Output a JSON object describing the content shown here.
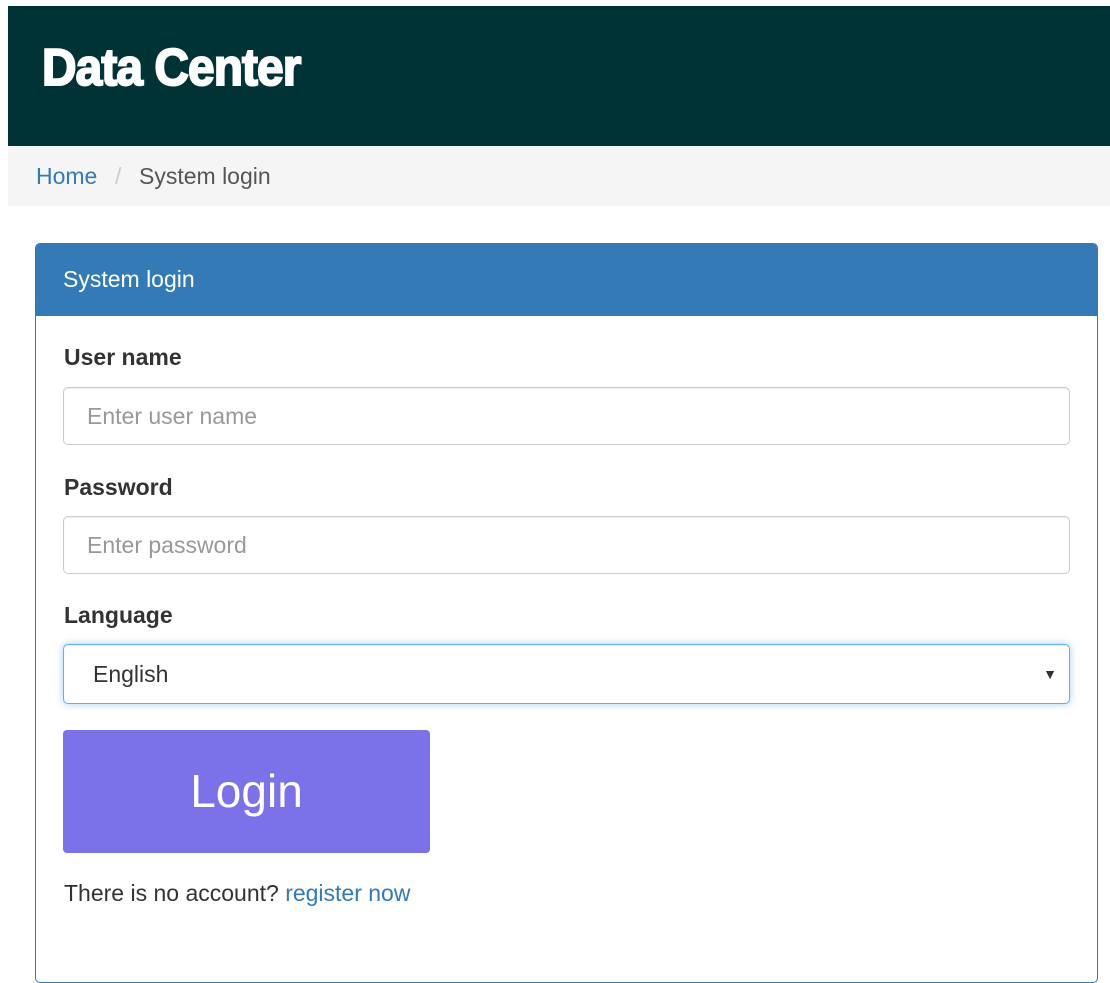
{
  "header": {
    "brand": "Data Center",
    "background_color": "#003336"
  },
  "breadcrumb": {
    "home": "Home",
    "separator": "/",
    "current": "System login"
  },
  "panel": {
    "title": "System login",
    "accent_color": "#337ab7"
  },
  "form": {
    "username": {
      "label": "User name",
      "placeholder": "Enter user name",
      "value": ""
    },
    "password": {
      "label": "Password",
      "placeholder": "Enter password",
      "value": ""
    },
    "language": {
      "label": "Language",
      "selected": "English",
      "arrow_icon": "caret-down-icon"
    },
    "login_button": {
      "label": "Login",
      "color": "#7b72ea"
    },
    "register": {
      "prompt": "There is no account?",
      "link_text": "register now"
    }
  }
}
